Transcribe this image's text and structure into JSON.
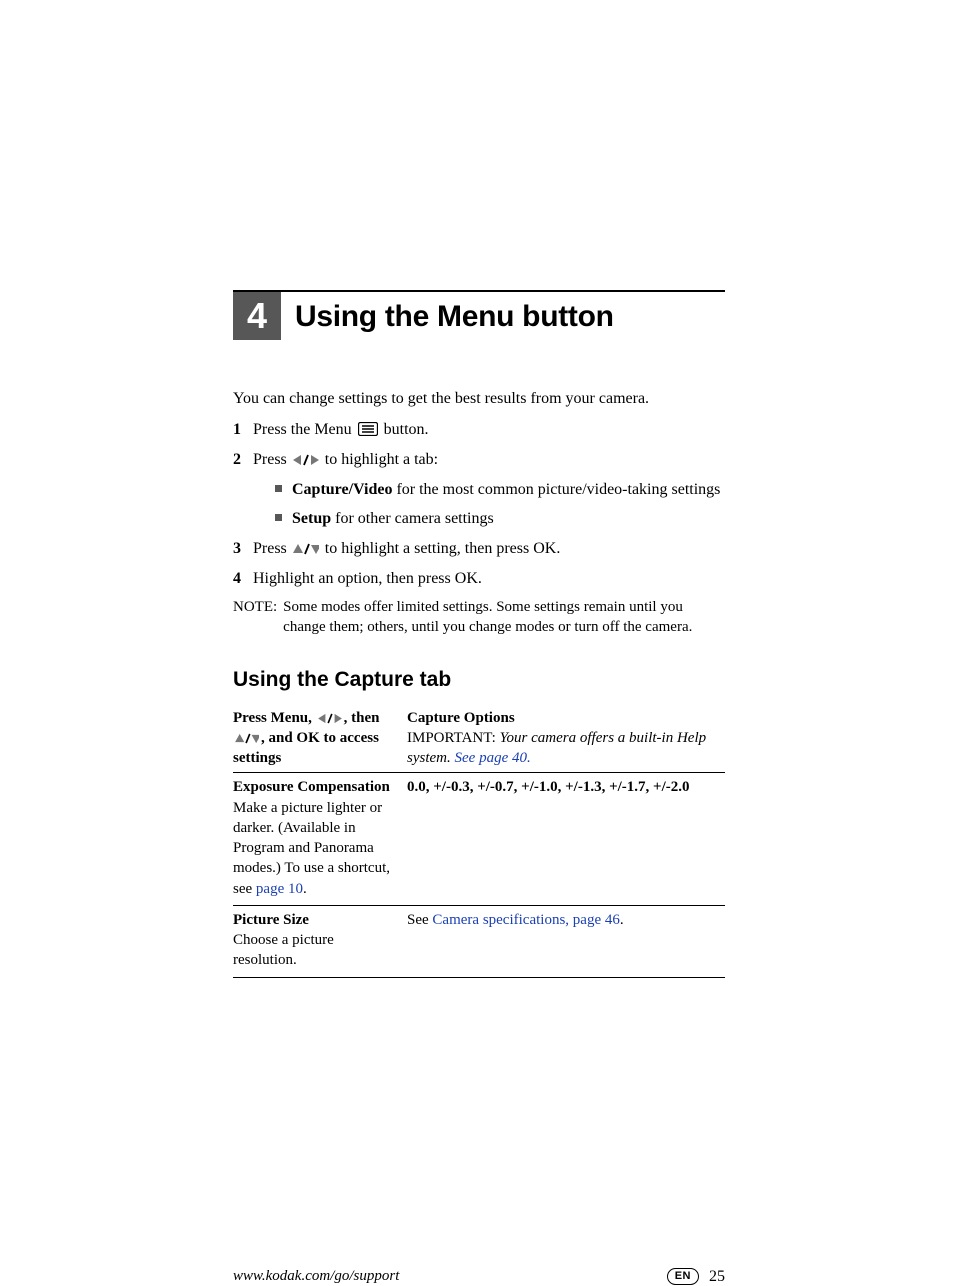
{
  "chapter": {
    "number": "4",
    "title": "Using the Menu button"
  },
  "intro": "You can change settings to get the best results from your camera.",
  "steps": {
    "s1": {
      "num": "1",
      "t1": "Press the Menu ",
      "t2": " button."
    },
    "s2": {
      "num": "2",
      "t1": "Press ",
      "t2": " to highlight a tab:"
    },
    "s2b1": {
      "bold": "Capture/Video",
      "rest": " for the most common picture/video-taking settings"
    },
    "s2b2": {
      "bold": "Setup",
      "rest": " for other camera settings"
    },
    "s3": {
      "num": "3",
      "t1": "Press ",
      "t2": " to highlight a setting, then press OK."
    },
    "s4": {
      "num": "4",
      "t1": "Highlight an option, then press OK."
    }
  },
  "note": {
    "label": "NOTE:",
    "text": "Some modes offer limited settings. Some settings remain until you change them; others, until you change modes or turn off the camera."
  },
  "section2": "Using the Capture tab",
  "table": {
    "header": {
      "left1": "Press Menu, ",
      "left2": ", then ",
      "left3": ", and OK to access settings",
      "right_title": "Capture Options",
      "imp_label": "IMPORTANT: ",
      "imp_text": "Your camera offers a built-in Help system. ",
      "imp_link": "See page 40."
    },
    "row1": {
      "title": "Exposure Compensation",
      "desc1": "Make a picture lighter or darker. (Available in Program and Panorama modes.) To use a shortcut, see ",
      "link": "page 10",
      "desc2": ".",
      "right": "0.0, +/-0.3, +/-0.7, +/-1.0, +/-1.3, +/-1.7, +/-2.0"
    },
    "row2": {
      "title": "Picture Size",
      "desc": "Choose a picture resolution.",
      "right_pre": "See ",
      "right_link": "Camera specifications, page 46",
      "right_post": "."
    }
  },
  "footer": {
    "url": "www.kodak.com/go/support",
    "lang": "EN",
    "page": "25"
  }
}
